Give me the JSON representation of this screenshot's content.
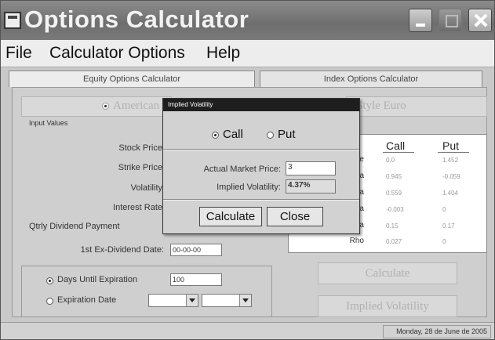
{
  "window": {
    "title": "Options Calculator"
  },
  "menu": [
    "File",
    "Calculator Options",
    "Help"
  ],
  "tabs": [
    {
      "label": "Equity Options Calculator",
      "active": true
    },
    {
      "label": "Index Options Calculator",
      "active": false
    }
  ],
  "style": {
    "american": "American",
    "european": "Style Euro"
  },
  "inputs": {
    "section_label": "Input Values",
    "stock_price": "Stock Price",
    "strike_price": "Strike Price",
    "volatility": "Volatility",
    "interest_rate": "Interest Rate",
    "dividend_payment": "Qtrly Dividend Payment",
    "ex_dividend_date_label": "1st Ex-Dividend Date:",
    "ex_dividend_date_value": "00-00-00",
    "days_until_expiration_label": "Days Until Expiration",
    "days_until_expiration_value": "100",
    "days_selected": true,
    "expiration_date_label": "Expiration Date"
  },
  "results": {
    "columns": [
      "Call",
      "Put"
    ],
    "rows": [
      {
        "label": "ice",
        "call": "0.0",
        "put": "1.452"
      },
      {
        "label": "lta",
        "call": "0.945",
        "put": "-0.059"
      },
      {
        "label": "ma",
        "call": "0.559",
        "put": "1.404"
      },
      {
        "label": "eta",
        "call": "-0.003",
        "put": "0"
      },
      {
        "label": "ga",
        "call": "0.15",
        "put": "0.17"
      },
      {
        "label": "Rho",
        "call": "0.027",
        "put": "0"
      }
    ]
  },
  "buttons": {
    "calculate": "Calculate",
    "implied_volatility": "Implied Volatility"
  },
  "status": {
    "date": "Monday, 28 de June de 2005"
  },
  "dialog": {
    "title": "Implied Volatility",
    "call_label": "Call",
    "put_label": "Put",
    "call_selected": true,
    "market_price_label": "Actual Market Price:",
    "market_price_value": "3",
    "implied_vol_label": "Implied Volatility:",
    "implied_vol_value": "4.37%",
    "calculate_label": "Calculate",
    "close_label": "Close"
  }
}
